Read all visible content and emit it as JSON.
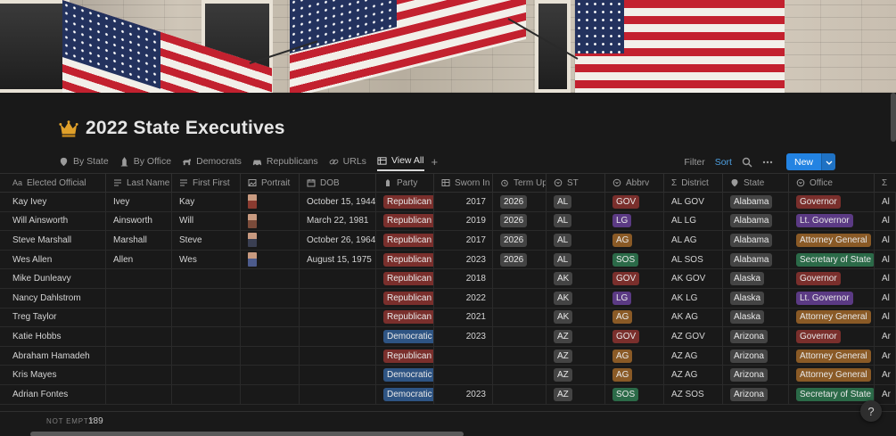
{
  "page": {
    "title": "2022 State Executives"
  },
  "tabs": [
    {
      "label": "By State",
      "icon": "tag-icon"
    },
    {
      "label": "By Office",
      "icon": "office-icon"
    },
    {
      "label": "Democrats",
      "icon": "donkey-icon"
    },
    {
      "label": "Republicans",
      "icon": "car-icon"
    },
    {
      "label": "URLs",
      "icon": "link-icon"
    },
    {
      "label": "View All",
      "icon": "table-icon"
    }
  ],
  "toolbar": {
    "filter": "Filter",
    "sort": "Sort",
    "new": "New"
  },
  "columns": [
    "Elected Official",
    "Last Name",
    "First First",
    "Portrait",
    "DOB",
    "Party",
    "Sworn In",
    "Term Up",
    "ST",
    "Abbrv",
    "District",
    "State",
    "Office"
  ],
  "colors": {
    "Republican": "#7a2f2c",
    "Democratic": "#2e5483",
    "GOV": "#7a2f2c",
    "LG": "#5b3a84",
    "AG": "#8a5a26",
    "SOS": "#2b6a48",
    "Governor": "#7a2f2c",
    "Lt. Governor": "#5b3a84",
    "Attorney General": "#8a5a26",
    "Secretary of State": "#2b6a48",
    "chip": "#444444"
  },
  "rows": [
    {
      "official": "Kay Ivey",
      "last": "Ivey",
      "first": "Kay",
      "portrait": true,
      "dob": "October 15, 1944",
      "party": "Republican",
      "sworn": "2017",
      "term": "2026",
      "st": "AL",
      "abbrv": "GOV",
      "district": "AL GOV",
      "state": "Alabama",
      "office": "Governor",
      "extra": "Al"
    },
    {
      "official": "Will Ainsworth",
      "last": "Ainsworth",
      "first": "Will",
      "portrait": true,
      "dob": "March 22, 1981",
      "party": "Republican",
      "sworn": "2019",
      "term": "2026",
      "st": "AL",
      "abbrv": "LG",
      "district": "AL LG",
      "state": "Alabama",
      "office": "Lt. Governor",
      "extra": "Al"
    },
    {
      "official": "Steve Marshall",
      "last": "Marshall",
      "first": "Steve",
      "portrait": true,
      "dob": "October 26, 1964",
      "party": "Republican",
      "sworn": "2017",
      "term": "2026",
      "st": "AL",
      "abbrv": "AG",
      "district": "AL AG",
      "state": "Alabama",
      "office": "Attorney General",
      "extra": "Al"
    },
    {
      "official": "Wes Allen",
      "last": "Allen",
      "first": "Wes",
      "portrait": true,
      "dob": "August 15, 1975",
      "party": "Republican",
      "sworn": "2023",
      "term": "2026",
      "st": "AL",
      "abbrv": "SOS",
      "district": "AL SOS",
      "state": "Alabama",
      "office": "Secretary of State",
      "extra": "Al"
    },
    {
      "official": "Mike Dunleavy",
      "last": "",
      "first": "",
      "portrait": false,
      "dob": "",
      "party": "Republican",
      "sworn": "2018",
      "term": "",
      "st": "AK",
      "abbrv": "GOV",
      "district": "AK GOV",
      "state": "Alaska",
      "office": "Governor",
      "extra": "Al"
    },
    {
      "official": "Nancy Dahlstrom",
      "last": "",
      "first": "",
      "portrait": false,
      "dob": "",
      "party": "Republican",
      "sworn": "2022",
      "term": "",
      "st": "AK",
      "abbrv": "LG",
      "district": "AK LG",
      "state": "Alaska",
      "office": "Lt. Governor",
      "extra": "Al"
    },
    {
      "official": "Treg Taylor",
      "last": "",
      "first": "",
      "portrait": false,
      "dob": "",
      "party": "Republican",
      "sworn": "2021",
      "term": "",
      "st": "AK",
      "abbrv": "AG",
      "district": "AK AG",
      "state": "Alaska",
      "office": "Attorney General",
      "extra": "Al"
    },
    {
      "official": "Katie Hobbs",
      "last": "",
      "first": "",
      "portrait": false,
      "dob": "",
      "party": "Democratic",
      "sworn": "2023",
      "term": "",
      "st": "AZ",
      "abbrv": "GOV",
      "district": "AZ GOV",
      "state": "Arizona",
      "office": "Governor",
      "extra": "Ar"
    },
    {
      "official": "Abraham Hamadeh",
      "last": "",
      "first": "",
      "portrait": false,
      "dob": "",
      "party": "Republican",
      "sworn": "",
      "term": "",
      "st": "AZ",
      "abbrv": "AG",
      "district": "AZ AG",
      "state": "Arizona",
      "office": "Attorney General",
      "extra": "Ar"
    },
    {
      "official": "Kris Mayes",
      "last": "",
      "first": "",
      "portrait": false,
      "dob": "",
      "party": "Democratic",
      "sworn": "",
      "term": "",
      "st": "AZ",
      "abbrv": "AG",
      "district": "AZ AG",
      "state": "Arizona",
      "office": "Attorney General",
      "extra": "Ar"
    },
    {
      "official": "Adrian Fontes",
      "last": "",
      "first": "",
      "portrait": false,
      "dob": "",
      "party": "Democratic",
      "sworn": "2023",
      "term": "",
      "st": "AZ",
      "abbrv": "SOS",
      "district": "AZ SOS",
      "state": "Arizona",
      "office": "Secretary of State",
      "extra": "Ar"
    }
  ],
  "footer": {
    "not_empty_label": "NOT EMPTY",
    "count": "189"
  },
  "help": "?"
}
